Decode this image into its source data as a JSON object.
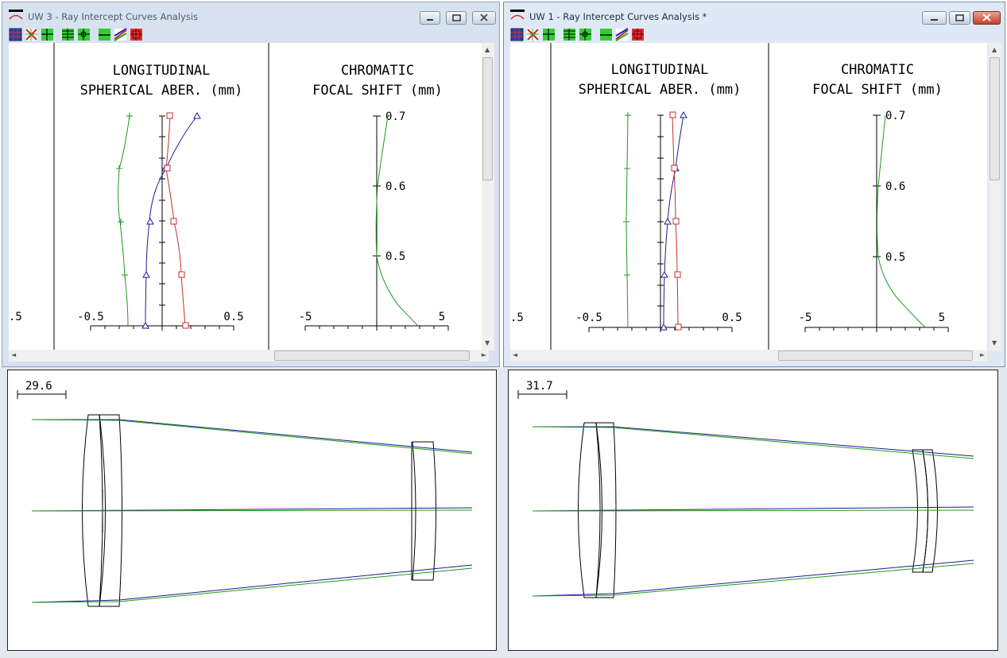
{
  "colors": {
    "blue": "#1c1c8c",
    "green": "#1f9a1f",
    "red": "#c03030",
    "black": "#000000"
  },
  "windows": [
    {
      "title": "UW 3 - Ray Intercept Curves Analysis",
      "lsa_title_1": "LONGITUDINAL",
      "lsa_title_2": "SPHERICAL ABER. (mm)",
      "cfs_title_1": "CHROMATIC",
      "cfs_title_2": "FOCAL SHIFT (mm)",
      "left_partial_tick": ".5",
      "lsa_tick_left": "-0.5",
      "lsa_tick_right": "0.5",
      "cfs_tick_left": "-5",
      "cfs_tick_right": "5",
      "cfs_y_07": "0.7",
      "cfs_y_06": "0.6",
      "cfs_y_05": "0.5",
      "scale_label": "29.6"
    },
    {
      "title": "UW 1 - Ray Intercept Curves Analysis *",
      "lsa_title_1": "LONGITUDINAL",
      "lsa_title_2": "SPHERICAL ABER. (mm)",
      "cfs_title_1": "CHROMATIC",
      "cfs_title_2": "FOCAL SHIFT (mm)",
      "left_partial_tick": ".5",
      "lsa_tick_left": "-0.5",
      "lsa_tick_right": "0.5",
      "cfs_tick_left": "-5",
      "cfs_tick_right": "5",
      "cfs_y_07": "0.7",
      "cfs_y_06": "0.6",
      "cfs_y_05": "0.5",
      "scale_label": "31.7"
    }
  ],
  "toolbar_icons": [
    "grid-icon",
    "zoom-icon",
    "crosshair-icon",
    "fit-icon",
    "pan-icon",
    "line-icon",
    "color-icon",
    "frame-icon"
  ]
}
